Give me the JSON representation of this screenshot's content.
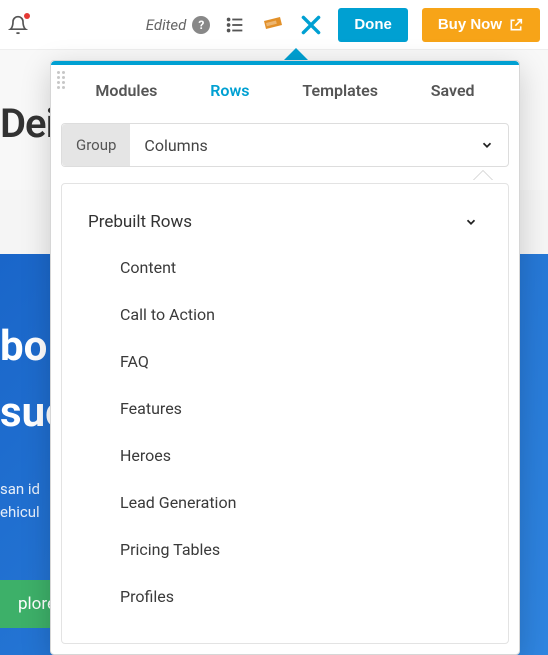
{
  "toolbar": {
    "edited_label": "Edited",
    "done_label": "Done",
    "buy_label": "Buy Now"
  },
  "background": {
    "title_fragment": "Dei",
    "hero_word_1": "bo",
    "hero_word_2": "suc",
    "lorem_line_1": "san id",
    "lorem_line_2": "ehicul",
    "cta_fragment": "plore"
  },
  "panel": {
    "tabs": {
      "modules": "Modules",
      "rows": "Rows",
      "templates": "Templates",
      "saved": "Saved"
    },
    "subbar": {
      "group": "Group",
      "columns": "Columns"
    },
    "section_title": "Prebuilt Rows",
    "items": [
      "Content",
      "Call to Action",
      "FAQ",
      "Features",
      "Heroes",
      "Lead Generation",
      "Pricing Tables",
      "Profiles"
    ]
  }
}
